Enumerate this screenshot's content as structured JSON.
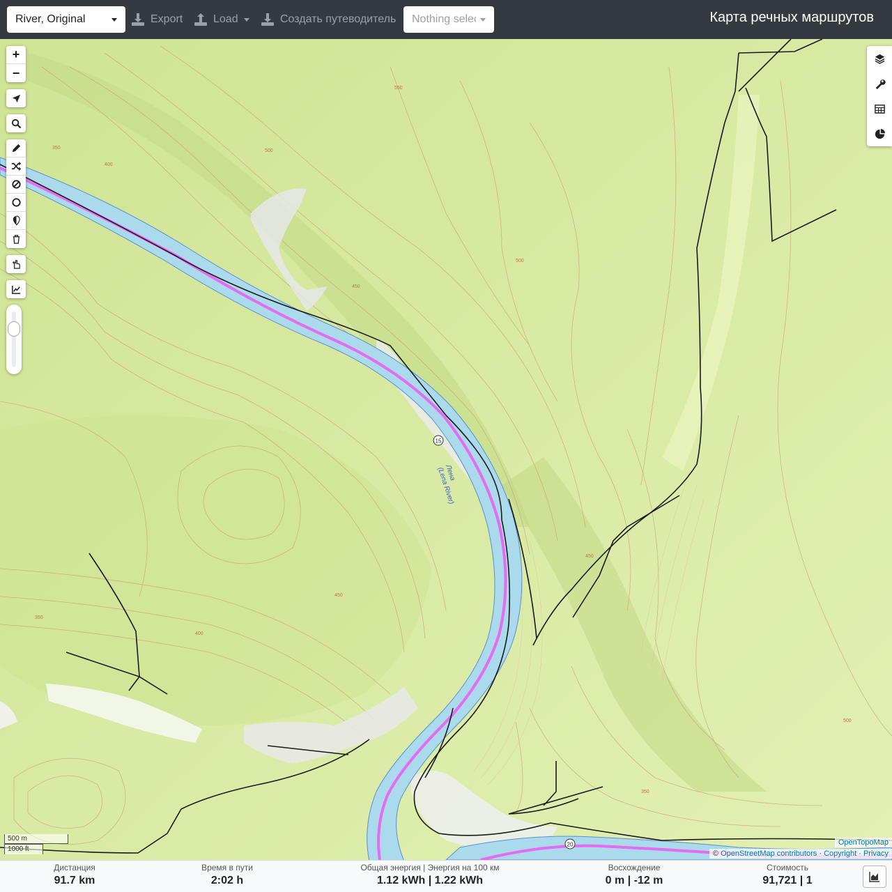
{
  "header": {
    "profile_select": "River, Original",
    "export_label": "Export",
    "load_label": "Load",
    "guide_label": "Создать путеводитель",
    "nothing_selected": "Nothing selected",
    "app_title": "Карта речных маршрутов"
  },
  "map": {
    "zoom_in": "+",
    "zoom_out": "−",
    "river_label_ru": "Лена",
    "river_label_en": "(Lena River)",
    "km_marker_1": "15",
    "km_marker_2": "20",
    "contour_labels": [
      "550",
      "500",
      "450",
      "400",
      "350"
    ],
    "scale_metric": "500 m",
    "scale_imperial": "1000 ft",
    "attribution_top": "OpenTopoMap",
    "attribution_prefix": "©",
    "attribution_osm": "OpenStreetMap contributors",
    "attribution_sep1": "·",
    "attribution_copyright": "Copyright",
    "attribution_sep2": "·",
    "attribution_privacy": "Privacy"
  },
  "stats": {
    "distance_label": "Дистанция",
    "distance_value": "91.7 km",
    "time_label": "Время в пути",
    "time_value": "2:02 h",
    "energy_label": "Общая энергия | Энергия на 100 км",
    "energy_value": "1.12 kWh | 1.22 kWh",
    "ascent_label": "Восхождение",
    "ascent_value": "0 m | -12 m",
    "cost_label": "Стоимость",
    "cost_value": "91,721 | 1"
  },
  "colors": {
    "topbar": "#343a40",
    "terrain": "#d9ec9f",
    "river": "#aadaec",
    "route": "#e46cf0",
    "contour": "#c9a27a"
  }
}
